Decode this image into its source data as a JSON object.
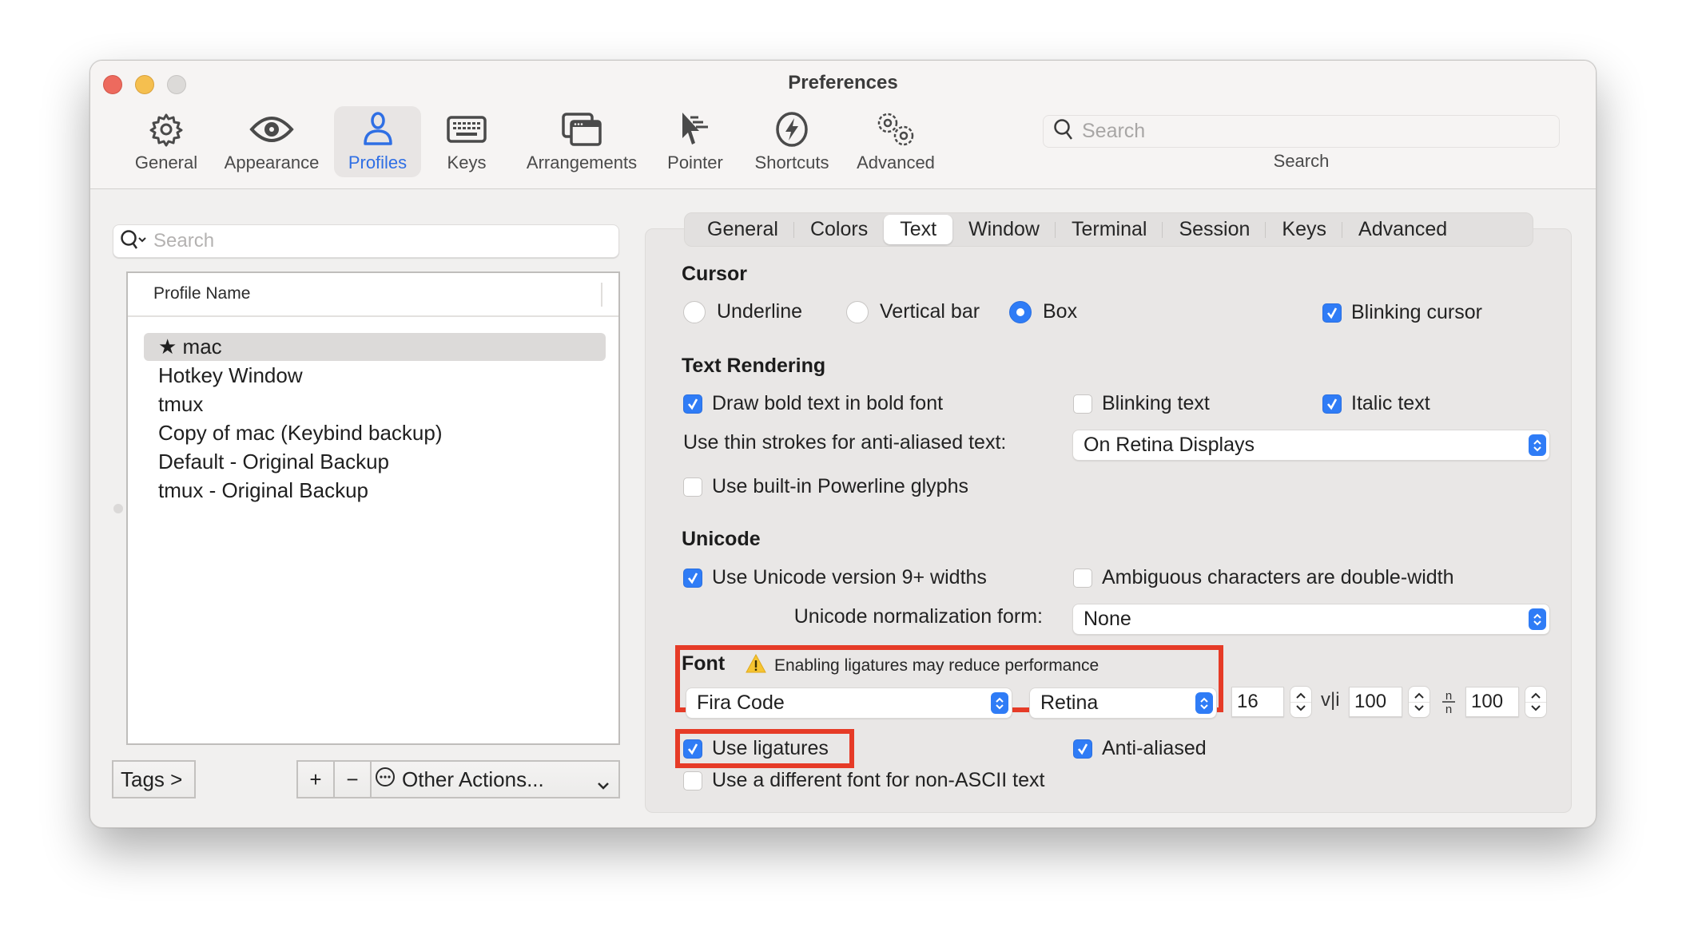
{
  "window": {
    "title": "Preferences"
  },
  "toolbar": {
    "items": [
      {
        "label": "General",
        "icon": "gear-icon",
        "active": false
      },
      {
        "label": "Appearance",
        "icon": "eye-icon",
        "active": false
      },
      {
        "label": "Profiles",
        "icon": "person-icon",
        "active": true
      },
      {
        "label": "Keys",
        "icon": "keyboard-icon",
        "active": false
      },
      {
        "label": "Arrangements",
        "icon": "windows-icon",
        "active": false
      },
      {
        "label": "Pointer",
        "icon": "pointer-icon",
        "active": false
      },
      {
        "label": "Shortcuts",
        "icon": "bolt-icon",
        "active": false
      },
      {
        "label": "Advanced",
        "icon": "gears-icon",
        "active": false
      }
    ],
    "search": {
      "placeholder": "Search",
      "label": "Search"
    }
  },
  "profiles": {
    "search_placeholder": "Search",
    "column_header": "Profile Name",
    "rows": [
      {
        "name": "mac",
        "default": true,
        "selected": true
      },
      {
        "name": "Hotkey Window",
        "default": false,
        "selected": false
      },
      {
        "name": "tmux",
        "default": false,
        "selected": false
      },
      {
        "name": "Copy of mac (Keybind backup)",
        "default": false,
        "selected": false
      },
      {
        "name": "Default - Original Backup",
        "default": false,
        "selected": false
      },
      {
        "name": "tmux - Original Backup",
        "default": false,
        "selected": false
      }
    ],
    "tags_button": "Tags >",
    "add_button": "+",
    "remove_button": "−",
    "other_actions": "Other Actions..."
  },
  "tabs": [
    "General",
    "Colors",
    "Text",
    "Window",
    "Terminal",
    "Session",
    "Keys",
    "Advanced"
  ],
  "active_tab": "Text",
  "cursor": {
    "heading": "Cursor",
    "options": [
      {
        "label": "Underline",
        "selected": false
      },
      {
        "label": "Vertical bar",
        "selected": false
      },
      {
        "label": "Box",
        "selected": true
      }
    ],
    "blinking": {
      "label": "Blinking cursor",
      "checked": true
    }
  },
  "text_rendering": {
    "heading": "Text Rendering",
    "bold": {
      "label": "Draw bold text in bold font",
      "checked": true
    },
    "blinking_text": {
      "label": "Blinking text",
      "checked": false
    },
    "italic": {
      "label": "Italic text",
      "checked": true
    },
    "thin_strokes_label": "Use thin strokes for anti-aliased text:",
    "thin_strokes_value": "On Retina Displays",
    "powerline": {
      "label": "Use built-in Powerline glyphs",
      "checked": false
    }
  },
  "unicode": {
    "heading": "Unicode",
    "widths": {
      "label": "Use Unicode version 9+ widths",
      "checked": true
    },
    "ambiguous": {
      "label": "Ambiguous characters are double-width",
      "checked": false
    },
    "normalization_label": "Unicode normalization form:",
    "normalization_value": "None"
  },
  "font": {
    "heading": "Font",
    "warning": "Enabling ligatures may reduce performance",
    "family": "Fira Code",
    "style": "Retina",
    "size": "16",
    "vertical_spacing_glyph": "v|i",
    "vertical_spacing": "100",
    "horizontal_spacing": "100",
    "ligatures": {
      "label": "Use ligatures",
      "checked": true
    },
    "anti_aliased": {
      "label": "Anti-aliased",
      "checked": true
    },
    "non_ascii": {
      "label": "Use a different font for non-ASCII text",
      "checked": false
    }
  },
  "colors": {
    "accent": "#2f7cf6",
    "highlight_box": "#e63b27",
    "active_toolbar": "#2f6fe4"
  }
}
